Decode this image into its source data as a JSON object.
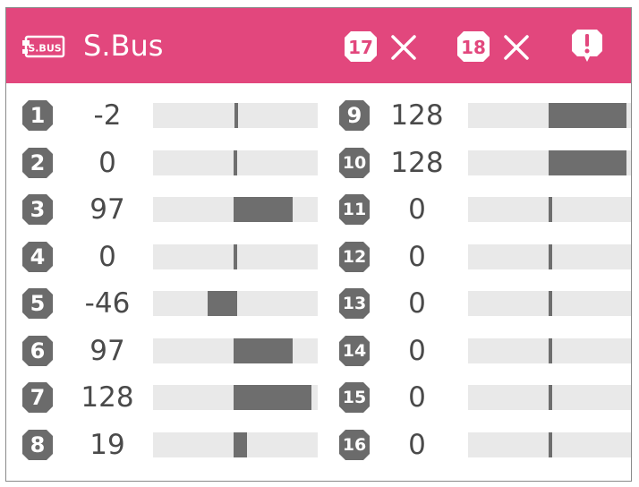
{
  "header": {
    "logo_text": "S.BUS",
    "title": "S.Bus",
    "ch17_label": "17",
    "ch18_label": "18",
    "ch17_status_icon": "x-icon",
    "ch18_status_icon": "x-icon",
    "alert_icon": "warning-icon"
  },
  "colors": {
    "header_bg": "#e2477d",
    "badge": "#6b6b6b",
    "bar_track": "#e9e9e9",
    "bar_fill": "#6e6e6e",
    "value_text": "#4a4a4a"
  },
  "scale": {
    "min": -128,
    "max": 128
  },
  "channels": [
    {
      "num": "1",
      "value": "-2"
    },
    {
      "num": "2",
      "value": "0"
    },
    {
      "num": "3",
      "value": "97"
    },
    {
      "num": "4",
      "value": "0"
    },
    {
      "num": "5",
      "value": "-46"
    },
    {
      "num": "6",
      "value": "97"
    },
    {
      "num": "7",
      "value": "128"
    },
    {
      "num": "8",
      "value": "19"
    },
    {
      "num": "9",
      "value": "128"
    },
    {
      "num": "10",
      "value": "128"
    },
    {
      "num": "11",
      "value": "0"
    },
    {
      "num": "12",
      "value": "0"
    },
    {
      "num": "13",
      "value": "0"
    },
    {
      "num": "14",
      "value": "0"
    },
    {
      "num": "15",
      "value": "0"
    },
    {
      "num": "16",
      "value": "0"
    }
  ]
}
